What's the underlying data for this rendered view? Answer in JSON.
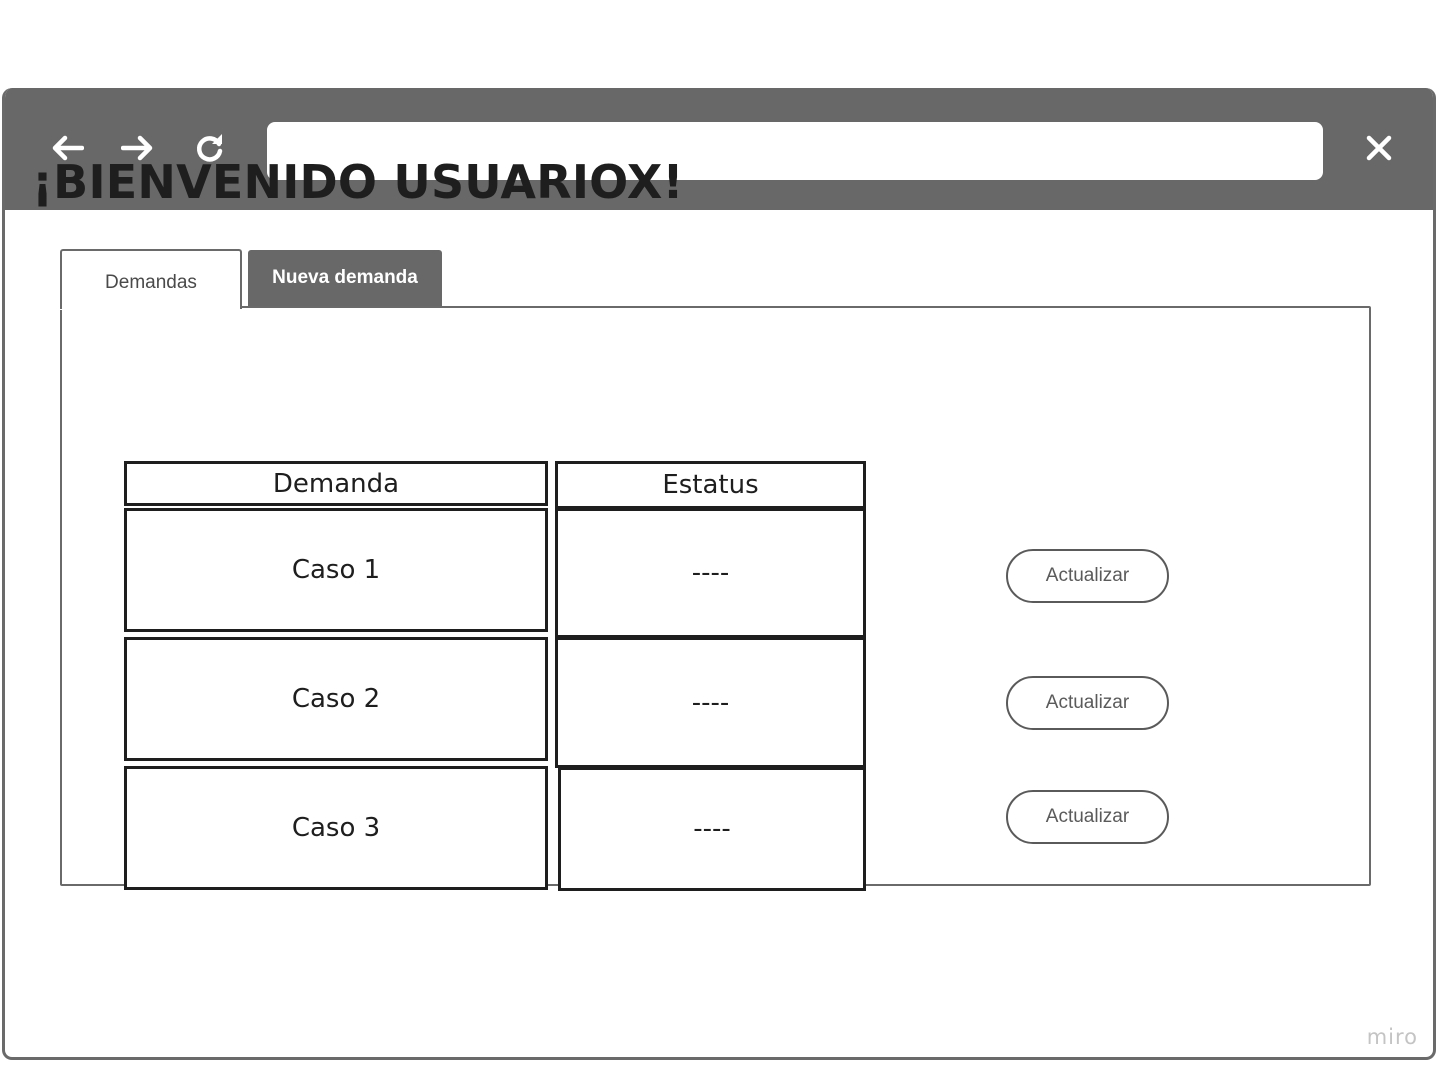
{
  "browser": {
    "url": "",
    "icons": {
      "back": "arrow-left-icon",
      "forward": "arrow-right-icon",
      "reload": "reload-icon",
      "close": "close-icon"
    },
    "chrome_color": "#686868"
  },
  "page": {
    "welcome_title": "¡BIENVENIDO USUARIOX!"
  },
  "tabs": [
    {
      "label": "Demandas",
      "active": true
    },
    {
      "label": "Nueva demanda",
      "active": false
    }
  ],
  "table": {
    "headers": [
      "Demanda",
      "Estatus"
    ],
    "rows": [
      {
        "demanda": "Caso 1",
        "estatus": "----",
        "action": "Actualizar"
      },
      {
        "demanda": "Caso 2",
        "estatus": "----",
        "action": "Actualizar"
      },
      {
        "demanda": "Caso 3",
        "estatus": "----",
        "action": "Actualizar"
      }
    ]
  },
  "watermark": "miro"
}
